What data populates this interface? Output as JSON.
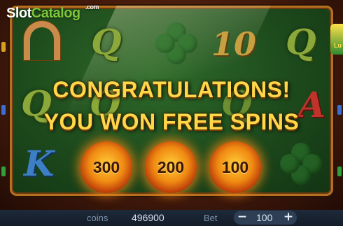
{
  "logo": {
    "slot": "Slot",
    "catalog": "Catalog",
    "com": ".com"
  },
  "corner_badge": {
    "text": "Lu"
  },
  "reel_symbols": {
    "q1": "Q",
    "ten": "10",
    "q2": "Q",
    "q3": "Q",
    "q4": "Q",
    "a": "A",
    "k": "K",
    "q5": "Q"
  },
  "banner": {
    "line1": "CONGRATULATIONS!",
    "line2": "YOU WON FREE SPINS"
  },
  "free_spin_options": [
    {
      "value": "300"
    },
    {
      "value": "200"
    },
    {
      "value": "100"
    }
  ],
  "bottom_bar": {
    "coins_label": "coins",
    "coins_value": "496900",
    "bet_label": "Bet",
    "bet_value": "100",
    "minus": "−",
    "plus": "+"
  },
  "colors": {
    "banner_text": "#ffd84a",
    "coin_glow": "#f08a12",
    "reel_bg": "#1d4a1c",
    "frame": "#b5701f"
  }
}
